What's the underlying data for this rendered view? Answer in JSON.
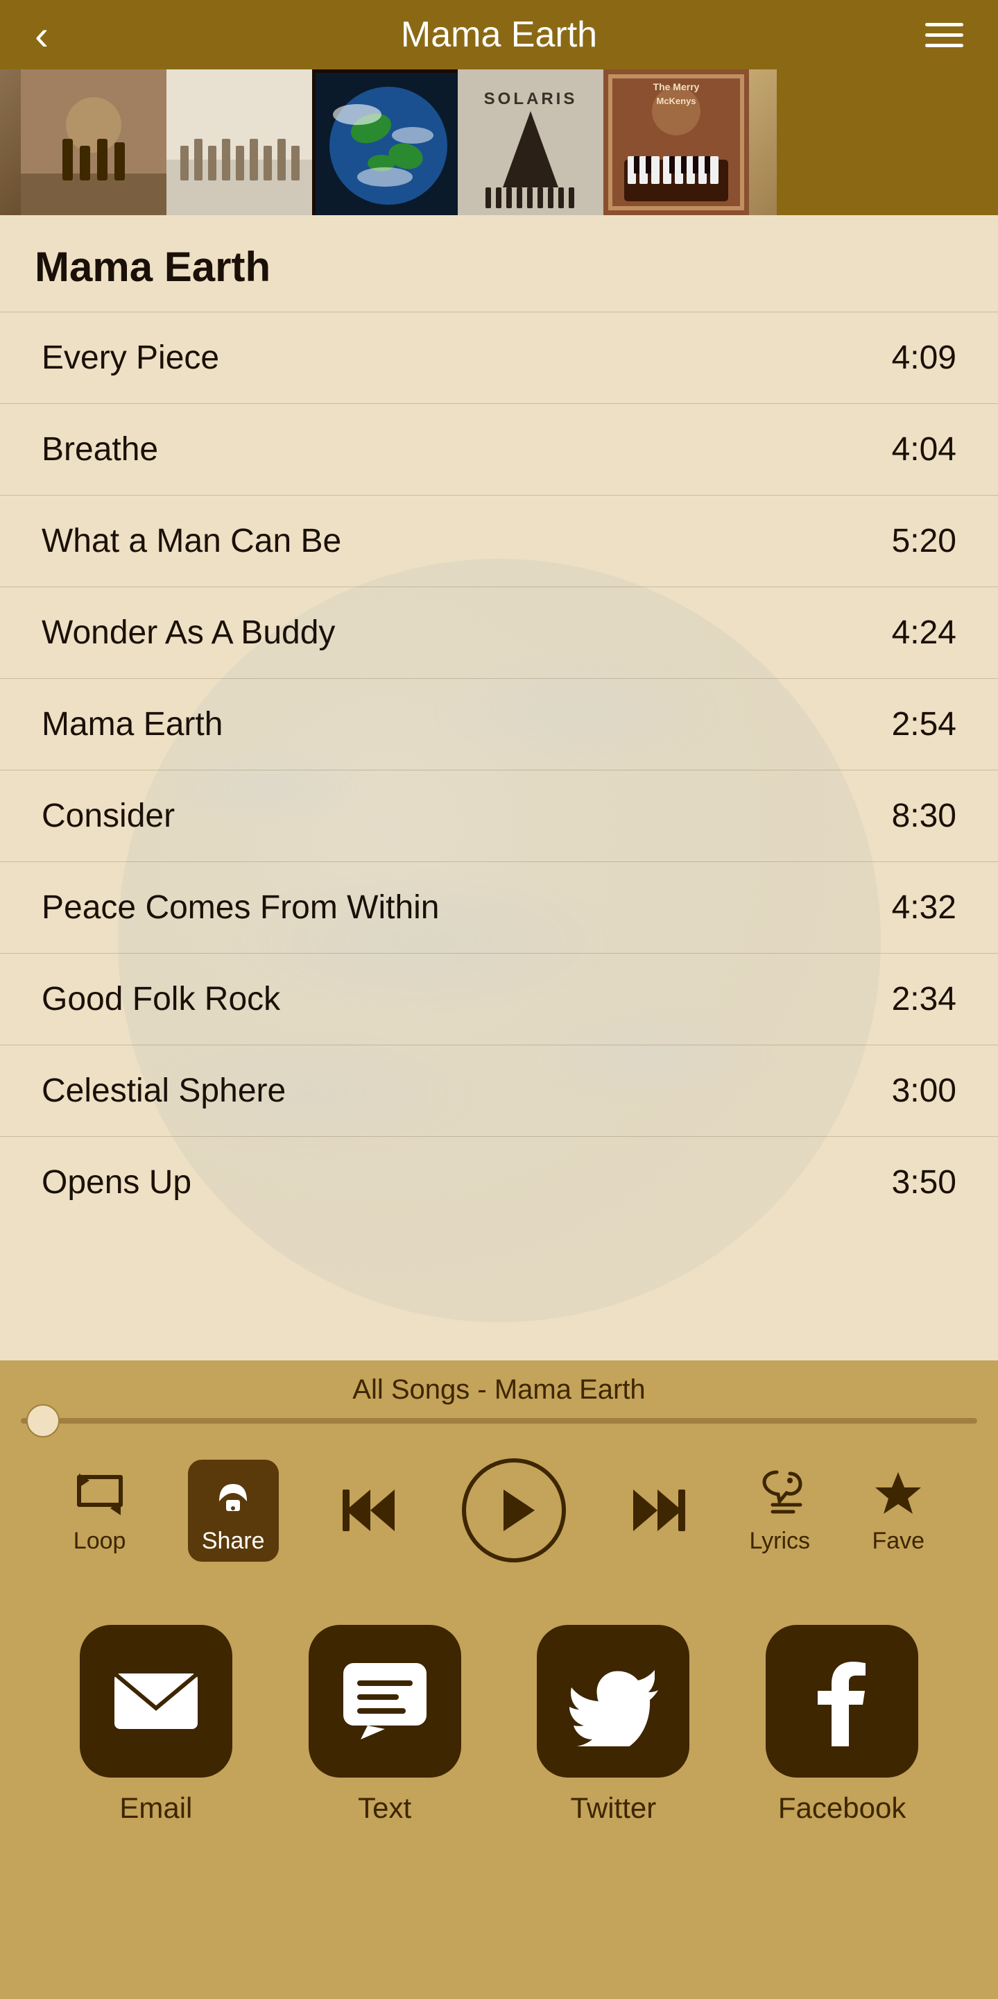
{
  "header": {
    "title": "Mama Earth",
    "back_label": "‹",
    "menu_label": "≡"
  },
  "albumCarousel": {
    "albums": [
      {
        "label": "album-1",
        "active": false
      },
      {
        "label": "album-2",
        "active": false
      },
      {
        "label": "album-3",
        "active": false
      },
      {
        "label": "album-4-mama-earth",
        "active": true
      },
      {
        "label": "album-5-solaris",
        "active": false
      },
      {
        "label": "album-6-merry-mcklens",
        "active": false
      },
      {
        "label": "album-7",
        "active": false
      }
    ]
  },
  "albumTitle": "Mama Earth",
  "songs": [
    {
      "title": "Every Piece",
      "duration": "4:09"
    },
    {
      "title": "Breathe",
      "duration": "4:04"
    },
    {
      "title": "What a Man Can Be",
      "duration": "5:20"
    },
    {
      "title": "Wonder As A Buddy",
      "duration": "4:24"
    },
    {
      "title": "Mama Earth",
      "duration": "2:54"
    },
    {
      "title": "Consider",
      "duration": "8:30"
    },
    {
      "title": "Peace Comes From Within",
      "duration": "4:32"
    },
    {
      "title": "Good Folk Rock",
      "duration": "2:34"
    },
    {
      "title": "Celestial Sphere",
      "duration": "3:00"
    },
    {
      "title": "Opens Up",
      "duration": "3:50"
    }
  ],
  "player": {
    "nowPlaying": "All Songs - Mama Earth",
    "progressPercent": 1,
    "controls": {
      "loop_label": "Loop",
      "share_label": "Share",
      "lyrics_label": "Lyrics",
      "fave_label": "Fave"
    }
  },
  "shareButtons": [
    {
      "label": "Email",
      "icon": "email"
    },
    {
      "label": "Text",
      "icon": "text"
    },
    {
      "label": "Twitter",
      "icon": "twitter"
    },
    {
      "label": "Facebook",
      "icon": "facebook"
    }
  ]
}
